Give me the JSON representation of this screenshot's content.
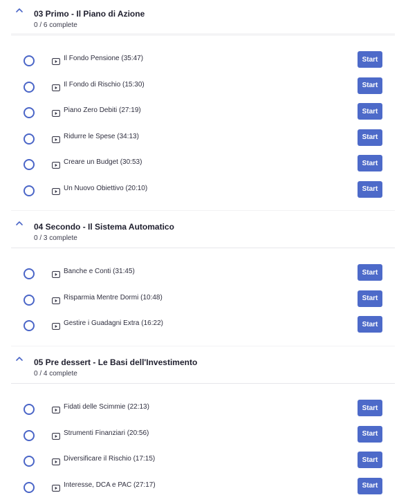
{
  "sections": [
    {
      "title": "03 Primo - Il Piano di Azione",
      "progress": "0 / 6 complete",
      "lessons": [
        {
          "title": "Il Fondo Pensione (35:47)",
          "action": "Start"
        },
        {
          "title": "Il Fondo di Rischio (15:30)",
          "action": "Start"
        },
        {
          "title": "Piano Zero Debiti (27:19)",
          "action": "Start"
        },
        {
          "title": "Ridurre le Spese (34:13)",
          "action": "Start"
        },
        {
          "title": "Creare un Budget (30:53)",
          "action": "Start"
        },
        {
          "title": "Un Nuovo Obiettivo (20:10)",
          "action": "Start"
        }
      ]
    },
    {
      "title": "04 Secondo - Il Sistema Automatico",
      "progress": "0 / 3 complete",
      "lessons": [
        {
          "title": "Banche e Conti (31:45)",
          "action": "Start"
        },
        {
          "title": "Risparmia Mentre Dormi (10:48)",
          "action": "Start"
        },
        {
          "title": "Gestire i Guadagni Extra (16:22)",
          "action": "Start"
        }
      ]
    },
    {
      "title": "05 Pre dessert - Le Basi dell'Investimento",
      "progress": "0 / 4 complete",
      "lessons": [
        {
          "title": "Fidati delle Scimmie (22:13)",
          "action": "Start"
        },
        {
          "title": "Strumenti Finanziari (20:56)",
          "action": "Start"
        },
        {
          "title": "Diversificare il Rischio (17:15)",
          "action": "Start"
        },
        {
          "title": "Interesse, DCA e PAC (27:17)",
          "action": "Start"
        }
      ]
    }
  ],
  "icons": {
    "collapse": "chevron-up-icon",
    "status": "incomplete-circle-icon",
    "lesson_type": "video-play-icon"
  },
  "colors": {
    "accent": "#4d6ac9",
    "status_ring": "#4a65c7",
    "divider": "#e6e6ea"
  }
}
